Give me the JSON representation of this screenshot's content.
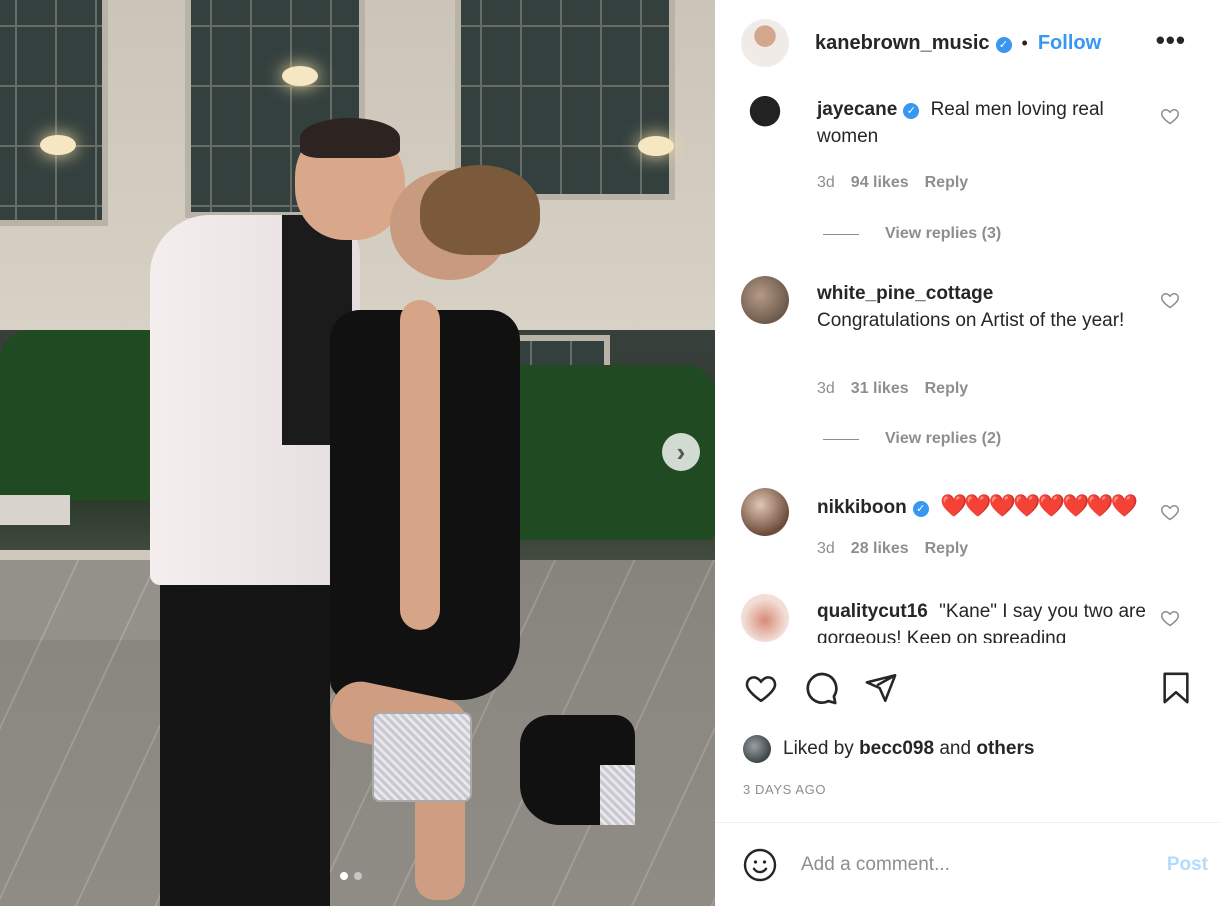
{
  "post": {
    "author": "kanebrown_music",
    "author_verified": true,
    "separator": "•",
    "follow_label": "Follow",
    "more_label": "•••",
    "carousel": {
      "total_slides": 2,
      "active_slide": 1
    }
  },
  "comments": [
    {
      "username": "jayecane",
      "verified": true,
      "text": "Real men loving real women",
      "age": "3d",
      "likes": "94 likes",
      "reply_label": "Reply",
      "view_replies": "View replies (3)"
    },
    {
      "username": "white_pine_cottage",
      "verified": false,
      "text": "Congratulations on Artist of the year!",
      "age": "3d",
      "likes": "31 likes",
      "reply_label": "Reply",
      "view_replies": "View replies (2)"
    },
    {
      "username": "nikkiboon",
      "verified": true,
      "text": "❤️❤️❤️❤️❤️❤️❤️❤️",
      "age": "3d",
      "likes": "28 likes",
      "reply_label": "Reply"
    },
    {
      "username": "qualitycut16",
      "verified": false,
      "text": "\"Kane\" I say you two are gorgeous! Keep on spreading"
    }
  ],
  "liked_by": {
    "prefix": "Liked by",
    "user": "becc098",
    "joiner": "and",
    "others": "others"
  },
  "timestamp": "3 DAYS AGO",
  "composer": {
    "placeholder": "Add a comment...",
    "post_label": "Post"
  },
  "icons": {
    "like": "heart-icon",
    "comment": "comment-icon",
    "share": "paper-plane-icon",
    "save": "bookmark-icon",
    "emoji": "smiley-icon",
    "next": "chevron-right-icon"
  },
  "colors": {
    "accent": "#3897f0",
    "text": "#262626",
    "muted": "#8e8e8e",
    "heart": "#ed4956",
    "post_disabled": "#b3dbff"
  }
}
